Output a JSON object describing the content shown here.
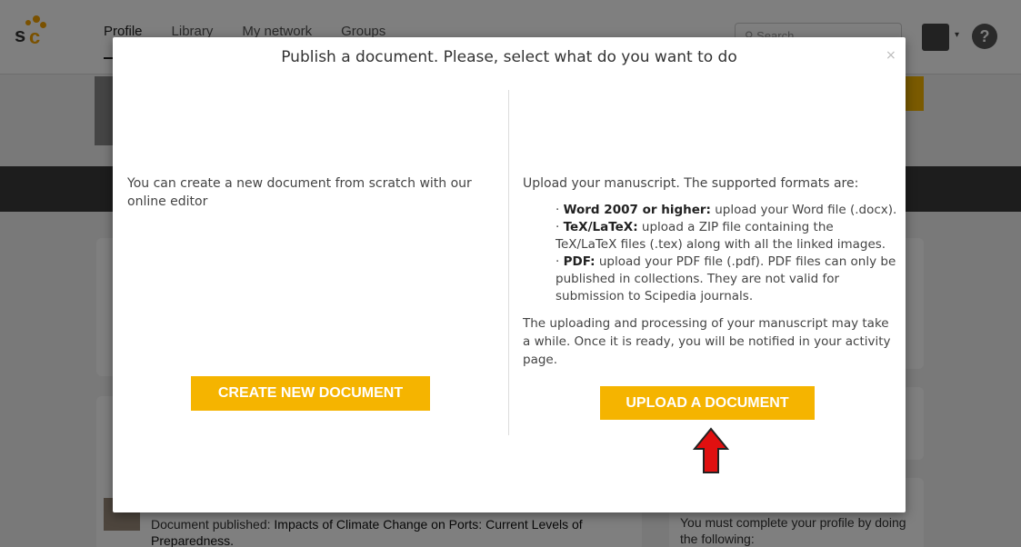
{
  "app": {
    "logo_text": "sc",
    "nav": [
      "Profile",
      "Library",
      "My network",
      "Groups"
    ],
    "search_placeholder": "Search",
    "help_glyph": "?"
  },
  "background": {
    "feed_prefix": "Document published:",
    "feed_title": "Impacts of Climate Change on Ports: Current Levels of Preparedness.",
    "side_text": "You must complete your profile by doing the following:"
  },
  "modal": {
    "title": "Publish a document. Please, select what do you want to do",
    "close_glyph": "×",
    "left": {
      "text": "You can create a new document from scratch with our online editor",
      "button": "CREATE NEW DOCUMENT"
    },
    "right": {
      "intro": "Upload your manuscript. The supported formats are:",
      "formats": [
        {
          "label": "Word 2007 or higher:",
          "desc": "upload your Word file (.docx)."
        },
        {
          "label": "TeX/LaTeX:",
          "desc": "upload a ZIP file containing the TeX/LaTeX files (.tex) along with all the linked images."
        },
        {
          "label": "PDF:",
          "desc": "upload your PDF file (.pdf). PDF files can only be published in collections. They are not valid for submission to Scipedia journals."
        }
      ],
      "note": "The uploading and processing of your manuscript may take a while. Once it is ready, you will be notified in your activity page.",
      "button": "UPLOAD A DOCUMENT"
    }
  },
  "colors": {
    "accent": "#f5b400",
    "arrow": "#e01010"
  }
}
